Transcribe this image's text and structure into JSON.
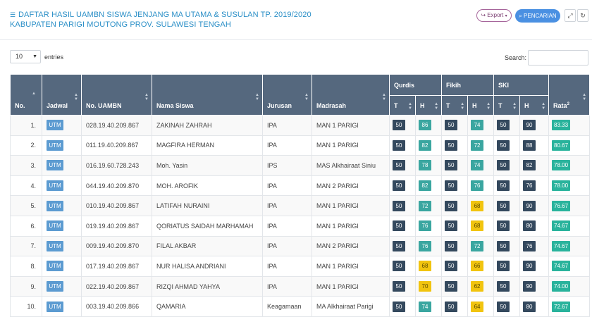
{
  "header": {
    "title_line1": "DAFTAR HASIL UAMBN SISWA JENJANG MA UTAMA & SUSULAN TP. 2019/2020",
    "title_line2": "KABUPATEN PARIGI MOUTONG PROV. SULAWESI TENGAH",
    "export_label": "Export",
    "search_button_label": "PENCARIAN"
  },
  "controls": {
    "page_length": "10",
    "entries_label": "entries",
    "search_label": "Search:"
  },
  "table": {
    "columns": {
      "no": "No.",
      "jadwal": "Jadwal",
      "no_uambn": "No. UAMBN",
      "nama": "Nama Siswa",
      "jurusan": "Jurusan",
      "madrasah": "Madrasah",
      "qurdis": "Qurdis",
      "fikih": "Fikih",
      "ski": "SKI",
      "rata": "Rata",
      "rata_sup": "2",
      "t": "T",
      "h": "H"
    },
    "rows": [
      {
        "no": "1.",
        "jadwal": "UTM",
        "uambn": "028.19.40.209.867",
        "nama": "ZAKINAH ZAHRAH",
        "jurusan": "IPA",
        "madrasah": "MAN 1 PARIGI",
        "qt": "50",
        "qh": "86",
        "ft": "50",
        "fh": "74",
        "st": "50",
        "sh": "90",
        "rata": "83.33"
      },
      {
        "no": "2.",
        "jadwal": "UTM",
        "uambn": "011.19.40.209.867",
        "nama": "MAGFIRA HERMAN",
        "jurusan": "IPA",
        "madrasah": "MAN 1 PARIGI",
        "qt": "50",
        "qh": "82",
        "ft": "50",
        "fh": "72",
        "st": "50",
        "sh": "88",
        "rata": "80.67"
      },
      {
        "no": "3.",
        "jadwal": "UTM",
        "uambn": "016.19.60.728.243",
        "nama": "Moh. Yasin",
        "jurusan": "IPS",
        "madrasah": "MAS Alkhairaat Siniu",
        "qt": "50",
        "qh": "78",
        "ft": "50",
        "fh": "74",
        "st": "50",
        "sh": "82",
        "rata": "78.00"
      },
      {
        "no": "4.",
        "jadwal": "UTM",
        "uambn": "044.19.40.209.870",
        "nama": "MOH. AROFIK",
        "jurusan": "IPA",
        "madrasah": "MAN 2 PARIGI",
        "qt": "50",
        "qh": "82",
        "ft": "50",
        "fh": "76",
        "st": "50",
        "sh": "76",
        "rata": "78.00"
      },
      {
        "no": "5.",
        "jadwal": "UTM",
        "uambn": "010.19.40.209.867",
        "nama": "LATIFAH NURAINI",
        "jurusan": "IPA",
        "madrasah": "MAN 1 PARIGI",
        "qt": "50",
        "qh": "72",
        "ft": "50",
        "fh": "68",
        "st": "50",
        "sh": "90",
        "rata": "76.67"
      },
      {
        "no": "6.",
        "jadwal": "UTM",
        "uambn": "019.19.40.209.867",
        "nama": "QORIATUS SAIDAH MARHAMAH",
        "jurusan": "IPA",
        "madrasah": "MAN 1 PARIGI",
        "qt": "50",
        "qh": "76",
        "ft": "50",
        "fh": "68",
        "st": "50",
        "sh": "80",
        "rata": "74.67"
      },
      {
        "no": "7.",
        "jadwal": "UTM",
        "uambn": "009.19.40.209.870",
        "nama": "FILAL AKBAR",
        "jurusan": "IPA",
        "madrasah": "MAN 2 PARIGI",
        "qt": "50",
        "qh": "76",
        "ft": "50",
        "fh": "72",
        "st": "50",
        "sh": "76",
        "rata": "74.67"
      },
      {
        "no": "8.",
        "jadwal": "UTM",
        "uambn": "017.19.40.209.867",
        "nama": "NUR HALISA ANDRIANI",
        "jurusan": "IPA",
        "madrasah": "MAN 1 PARIGI",
        "qt": "50",
        "qh": "68",
        "ft": "50",
        "fh": "66",
        "st": "50",
        "sh": "90",
        "rata": "74.67"
      },
      {
        "no": "9.",
        "jadwal": "UTM",
        "uambn": "022.19.40.209.867",
        "nama": "RIZQI AHMAD YAHYA",
        "jurusan": "IPA",
        "madrasah": "MAN 1 PARIGI",
        "qt": "50",
        "qh": "70",
        "ft": "50",
        "fh": "62",
        "st": "50",
        "sh": "90",
        "rata": "74.00"
      },
      {
        "no": "10.",
        "jadwal": "UTM",
        "uambn": "003.19.40.209.866",
        "nama": "QAMARIA",
        "jurusan": "Keagamaan",
        "madrasah": "MA Alkhairaat Parigi",
        "qt": "50",
        "qh": "74",
        "ft": "50",
        "fh": "64",
        "st": "50",
        "sh": "80",
        "rata": "72.67"
      }
    ]
  }
}
